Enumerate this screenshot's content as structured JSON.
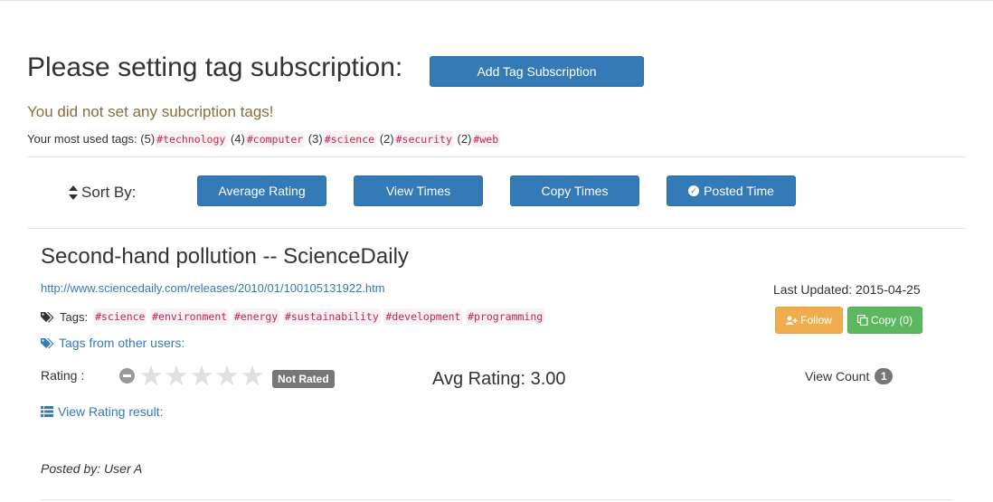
{
  "header": {
    "title": "Please setting tag subscription:",
    "add_button": "Add Tag Subscription",
    "warning": "You did not set any subcription tags!",
    "most_used_label": "Your most used tags:",
    "most_used": [
      {
        "count": "(5)",
        "tag": "#technology"
      },
      {
        "count": "(4)",
        "tag": "#computer"
      },
      {
        "count": "(3)",
        "tag": "#science"
      },
      {
        "count": "(2)",
        "tag": "#security"
      },
      {
        "count": "(2)",
        "tag": "#web"
      }
    ]
  },
  "sort": {
    "label": "Sort By:",
    "buttons": [
      "Average Rating",
      "View Times",
      "Copy Times",
      "Posted Time"
    ]
  },
  "post": {
    "title": "Second-hand pollution -- ScienceDaily",
    "url": "http://www.sciencedaily.com/releases/2010/01/100105131922.htm",
    "tags_label": "Tags:",
    "tags": [
      "#science",
      "#environment",
      "#energy",
      "#sustainability",
      "#development",
      "#programming"
    ],
    "tags_other": "Tags from other users:",
    "rating_label": "Rating :",
    "not_rated": "Not Rated",
    "avg_rating": "Avg Rating: 3.00",
    "view_rating": "View Rating result:",
    "posted_by": "Posted by: User A",
    "last_updated": "Last Updated: 2015-04-25",
    "follow": "Follow",
    "copy": "Copy (0)",
    "view_count_label": "View Count",
    "view_count": "1",
    "stars_filled": 0,
    "stars_total": 5
  },
  "colors": {
    "primary": "#337ab7",
    "warning_text": "#8a6d3b",
    "tag_text": "#c7254e",
    "follow": "#f0ad4e",
    "copy": "#5cb85c",
    "badge": "#777777"
  }
}
